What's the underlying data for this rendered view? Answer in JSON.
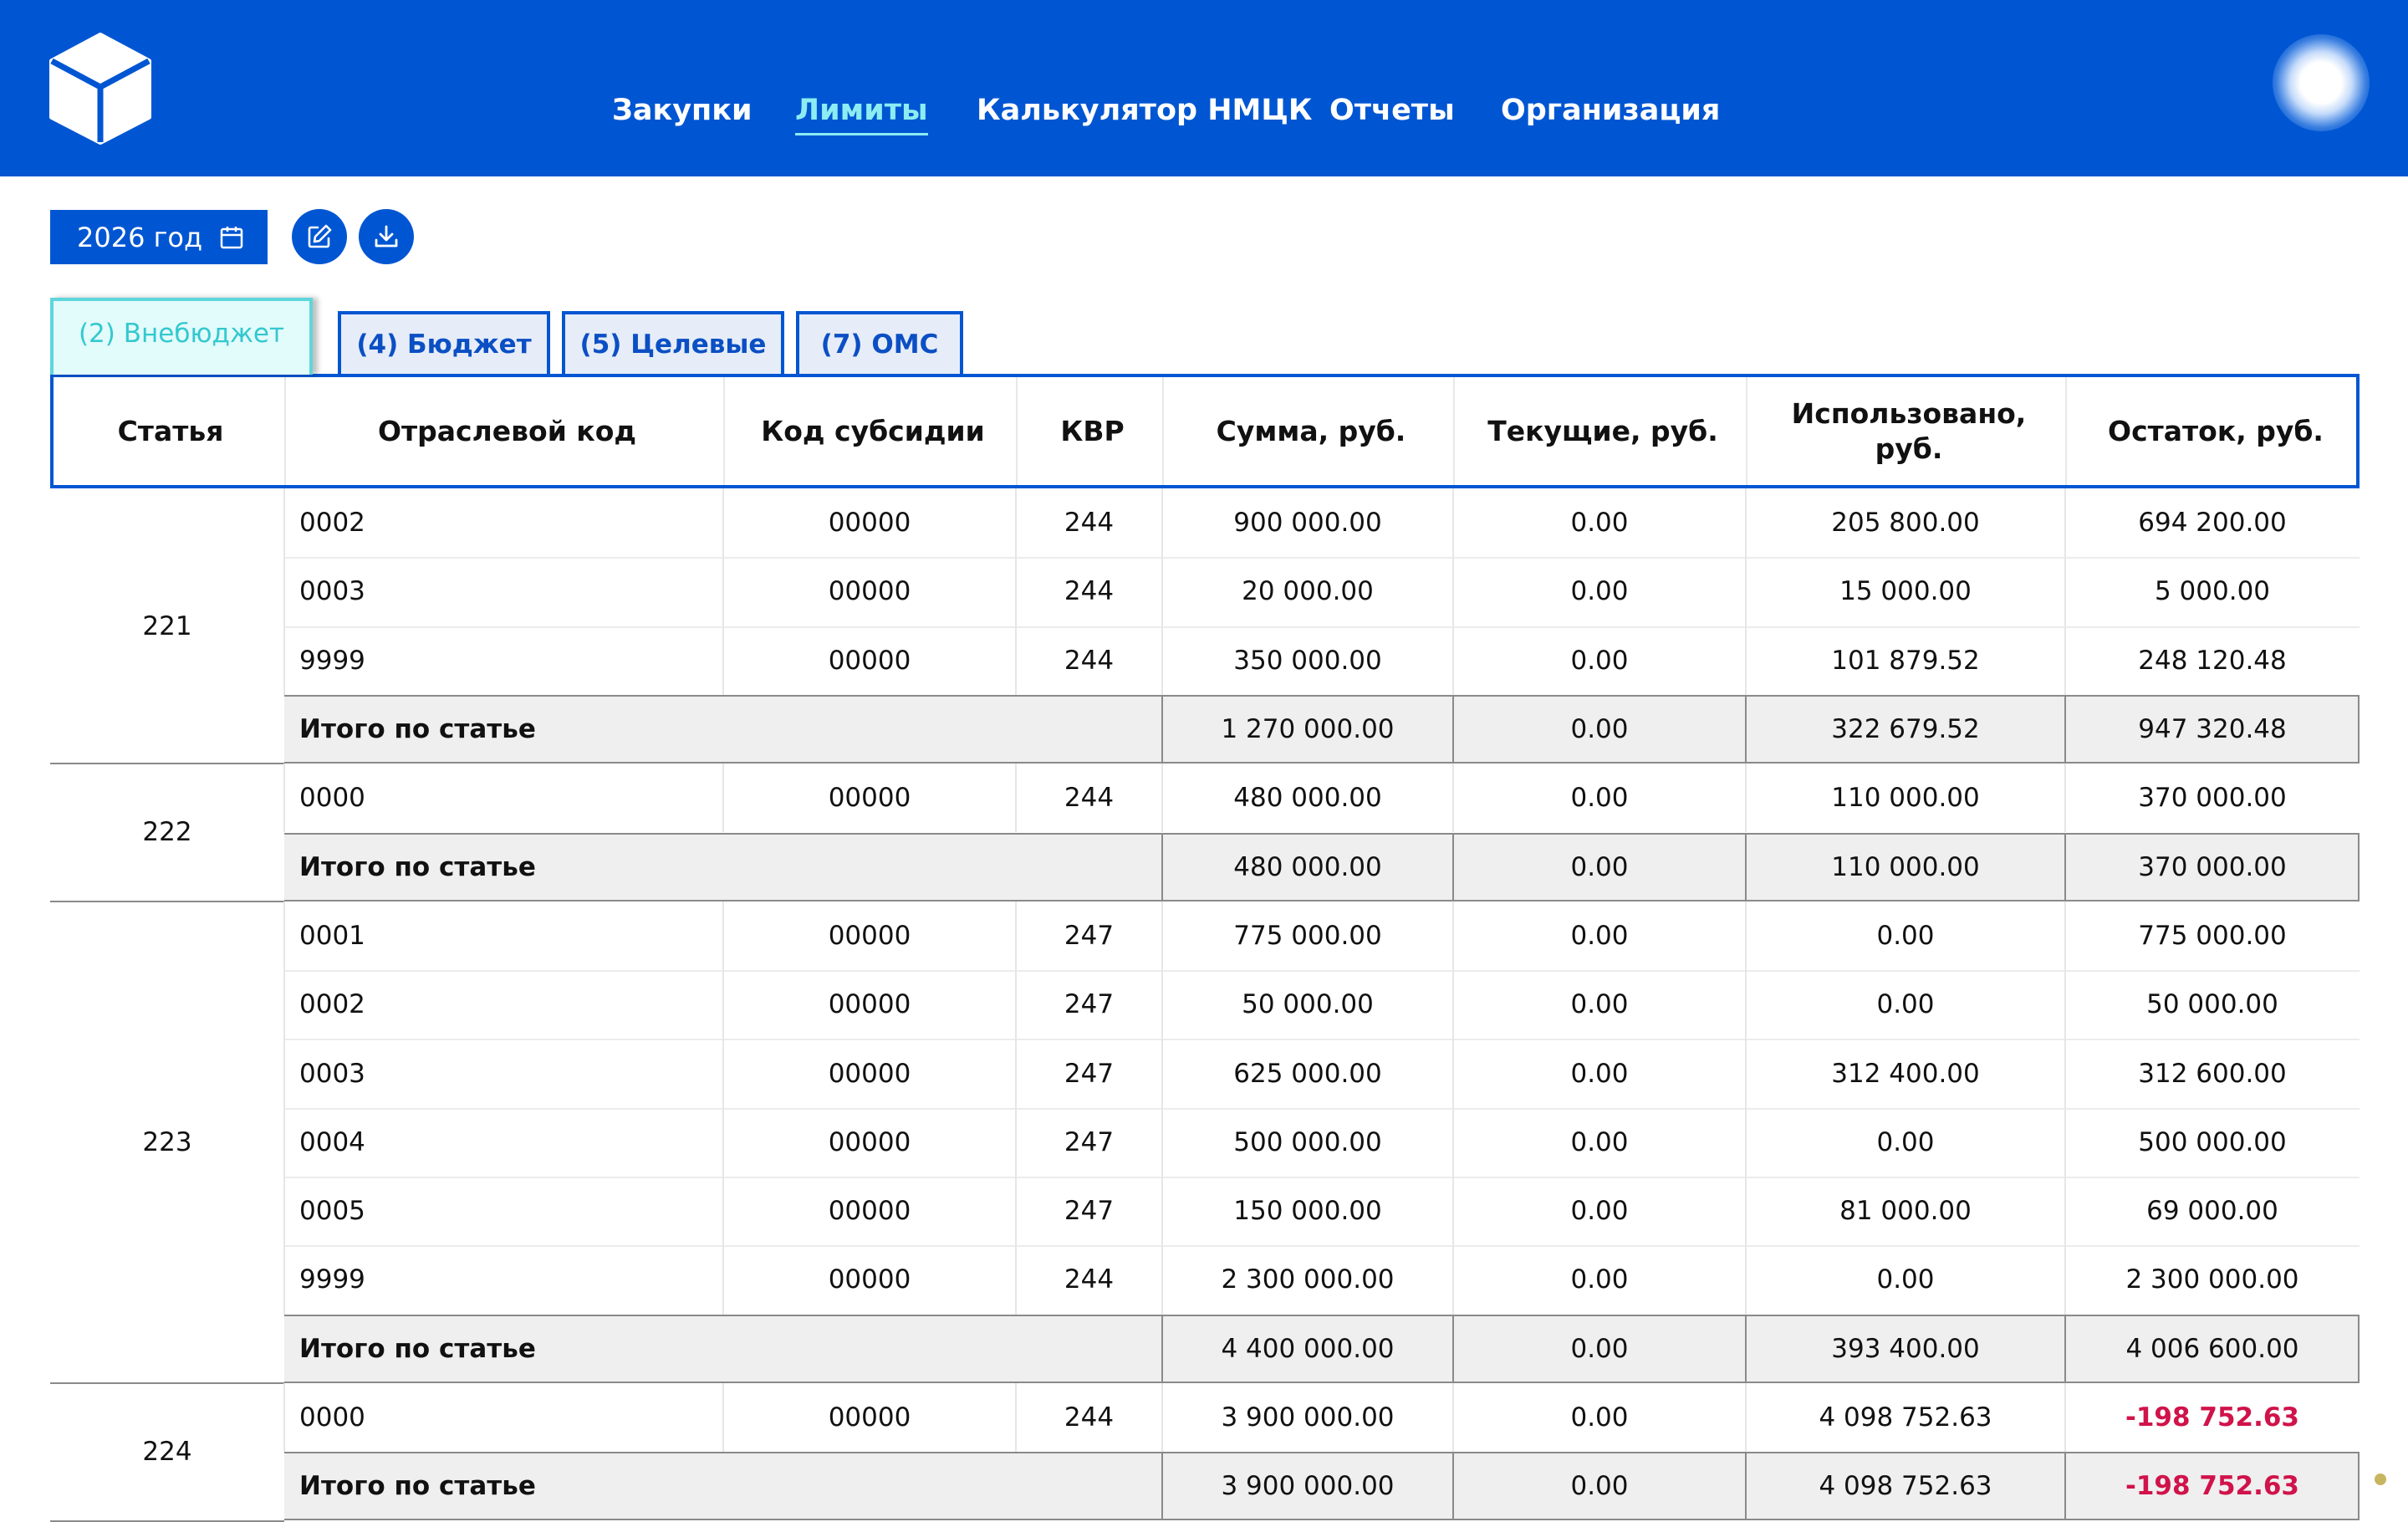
{
  "nav": {
    "items": [
      {
        "label": "Закупки",
        "active": false
      },
      {
        "label": "Лимиты",
        "active": true
      },
      {
        "label": "Калькулятор НМЦК",
        "active": false
      },
      {
        "label": "Отчеты",
        "active": false
      },
      {
        "label": "Организация",
        "active": false
      }
    ]
  },
  "toolbar": {
    "year_label": "2026 год",
    "year_icon": "calendar-icon",
    "edit_icon": "edit-icon",
    "download_icon": "download-icon"
  },
  "tabs": [
    {
      "label": "(2) Внебюджет",
      "active": true
    },
    {
      "label": "(4) Бюджет",
      "active": false
    },
    {
      "label": "(5) Целевые",
      "active": false
    },
    {
      "label": "(7) ОМС",
      "active": false
    }
  ],
  "table": {
    "headers": [
      "Статья",
      "Отраслевой код",
      "Код субсидии",
      "КВР",
      "Сумма, руб.",
      "Текущие, руб.",
      "Использовано, руб.",
      "Остаток, руб."
    ],
    "total_label": "Итого по статье",
    "groups": [
      {
        "article": "221",
        "rows": [
          {
            "code": "0002",
            "subsidy": "00000",
            "kvr": "244",
            "sum": "900 000.00",
            "current": "0.00",
            "used": "205 800.00",
            "rest": "694 200.00",
            "negative": false
          },
          {
            "code": "0003",
            "subsidy": "00000",
            "kvr": "244",
            "sum": "20 000.00",
            "current": "0.00",
            "used": "15 000.00",
            "rest": "5 000.00",
            "negative": false
          },
          {
            "code": "9999",
            "subsidy": "00000",
            "kvr": "244",
            "sum": "350 000.00",
            "current": "0.00",
            "used": "101 879.52",
            "rest": "248 120.48",
            "negative": false
          }
        ],
        "total": {
          "sum": "1 270 000.00",
          "current": "0.00",
          "used": "322 679.52",
          "rest": "947 320.48",
          "negative": false
        }
      },
      {
        "article": "222",
        "rows": [
          {
            "code": "0000",
            "subsidy": "00000",
            "kvr": "244",
            "sum": "480 000.00",
            "current": "0.00",
            "used": "110 000.00",
            "rest": "370 000.00",
            "negative": false
          }
        ],
        "total": {
          "sum": "480 000.00",
          "current": "0.00",
          "used": "110 000.00",
          "rest": "370 000.00",
          "negative": false
        }
      },
      {
        "article": "223",
        "rows": [
          {
            "code": "0001",
            "subsidy": "00000",
            "kvr": "247",
            "sum": "775 000.00",
            "current": "0.00",
            "used": "0.00",
            "rest": "775 000.00",
            "negative": false
          },
          {
            "code": "0002",
            "subsidy": "00000",
            "kvr": "247",
            "sum": "50 000.00",
            "current": "0.00",
            "used": "0.00",
            "rest": "50 000.00",
            "negative": false
          },
          {
            "code": "0003",
            "subsidy": "00000",
            "kvr": "247",
            "sum": "625 000.00",
            "current": "0.00",
            "used": "312 400.00",
            "rest": "312 600.00",
            "negative": false
          },
          {
            "code": "0004",
            "subsidy": "00000",
            "kvr": "247",
            "sum": "500 000.00",
            "current": "0.00",
            "used": "0.00",
            "rest": "500 000.00",
            "negative": false
          },
          {
            "code": "0005",
            "subsidy": "00000",
            "kvr": "247",
            "sum": "150 000.00",
            "current": "0.00",
            "used": "81 000.00",
            "rest": "69 000.00",
            "negative": false
          },
          {
            "code": "9999",
            "subsidy": "00000",
            "kvr": "244",
            "sum": "2 300 000.00",
            "current": "0.00",
            "used": "0.00",
            "rest": "2 300 000.00",
            "negative": false
          }
        ],
        "total": {
          "sum": "4 400 000.00",
          "current": "0.00",
          "used": "393 400.00",
          "rest": "4 006 600.00",
          "negative": false
        }
      },
      {
        "article": "224",
        "rows": [
          {
            "code": "0000",
            "subsidy": "00000",
            "kvr": "244",
            "sum": "3 900 000.00",
            "current": "0.00",
            "used": "4 098 752.63",
            "rest": "-198 752.63",
            "negative": true
          }
        ],
        "total": {
          "sum": "3 900 000.00",
          "current": "0.00",
          "used": "4 098 752.63",
          "rest": "-198 752.63",
          "negative": true
        }
      }
    ]
  },
  "colors": {
    "brand": "#0056d2",
    "active_tab": "#33c8cf",
    "negative": "#d0134a"
  }
}
